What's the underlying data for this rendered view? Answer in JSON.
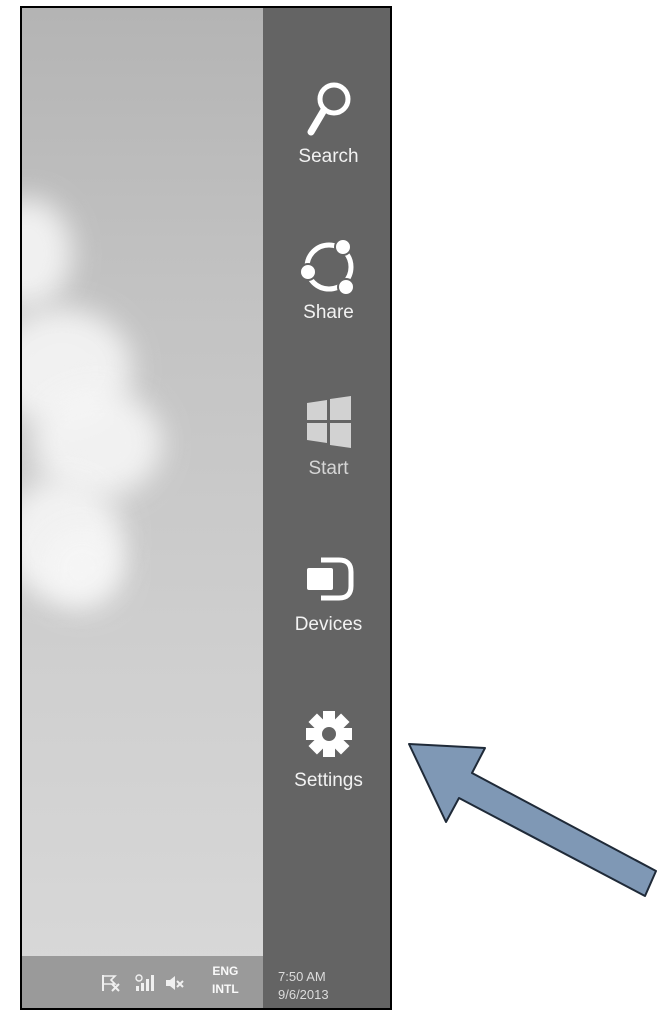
{
  "charms": [
    {
      "label": "Search",
      "icon": "search-icon"
    },
    {
      "label": "Share",
      "icon": "share-icon"
    },
    {
      "label": "Start",
      "icon": "windows-start-icon"
    },
    {
      "label": "Devices",
      "icon": "devices-icon"
    },
    {
      "label": "Settings",
      "icon": "gear-icon"
    }
  ],
  "taskbar": {
    "tray_icons": [
      "action-center-flag-icon",
      "network-signal-icon",
      "volume-muted-icon"
    ],
    "language_line1": "ENG",
    "language_line2": "INTL",
    "time": "7:50 AM",
    "date": "9/6/2013"
  },
  "annotation": {
    "icon": "pointer-arrow-icon",
    "color": "#7f98b5"
  },
  "colors": {
    "charm_bar": "#646464",
    "wallpaper": "#c8c8c8"
  }
}
